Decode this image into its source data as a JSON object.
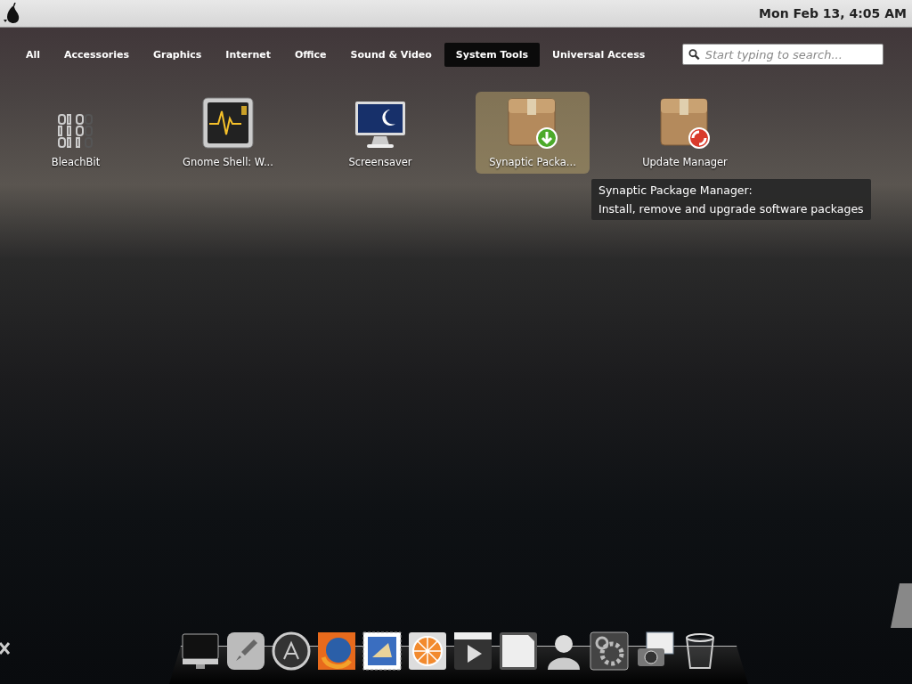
{
  "top_bar": {
    "clock": "Mon Feb 13,  4:05 AM"
  },
  "categories": [
    {
      "label": "All",
      "selected": false
    },
    {
      "label": "Accessories",
      "selected": false
    },
    {
      "label": "Graphics",
      "selected": false
    },
    {
      "label": "Internet",
      "selected": false
    },
    {
      "label": "Office",
      "selected": false
    },
    {
      "label": "Sound & Video",
      "selected": false
    },
    {
      "label": "System Tools",
      "selected": true
    },
    {
      "label": "Universal Access",
      "selected": false
    }
  ],
  "search": {
    "placeholder": "Start typing to search..."
  },
  "apps": [
    {
      "name": "BleachBit",
      "kind": "binary",
      "selected": false
    },
    {
      "name": "Gnome Shell: W...",
      "kind": "monitor",
      "selected": false
    },
    {
      "name": "Screensaver",
      "kind": "screen",
      "selected": false
    },
    {
      "name": "Synaptic Packa...",
      "kind": "install",
      "selected": true
    },
    {
      "name": "Update Manager",
      "kind": "update",
      "selected": false
    }
  ],
  "tooltip": {
    "title": "Synaptic Package Manager:",
    "description": "Install, remove and upgrade software packages"
  }
}
